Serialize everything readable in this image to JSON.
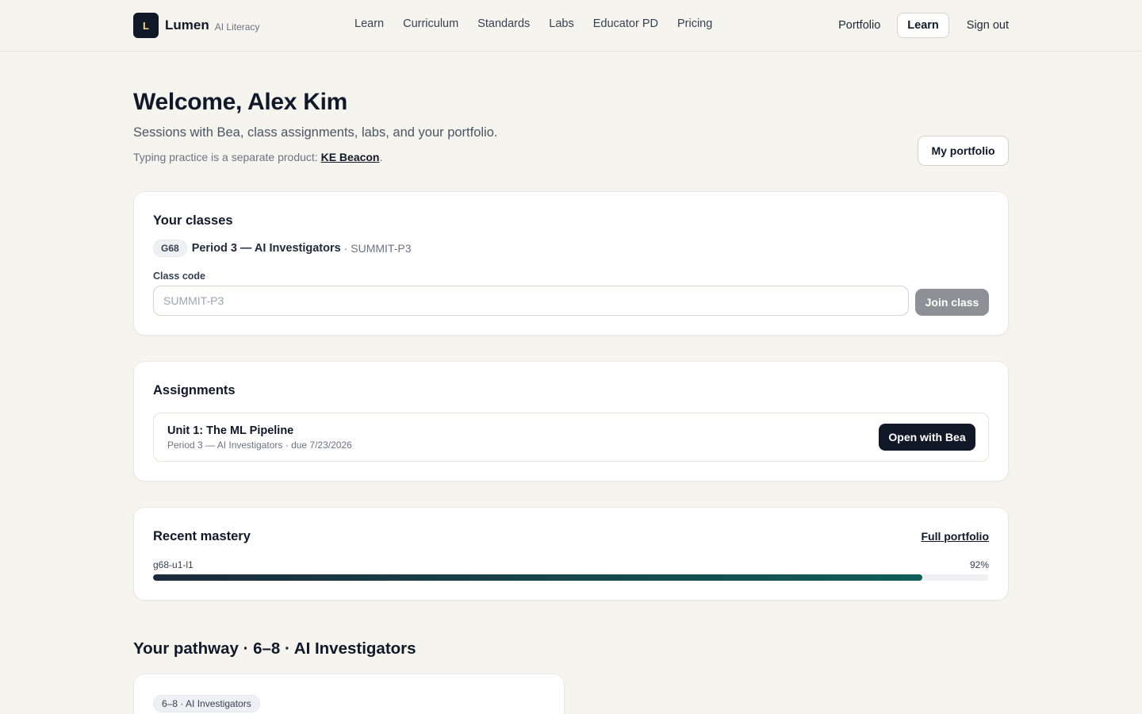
{
  "brand": {
    "logo_letter": "L",
    "name": "Lumen",
    "subtitle": "AI Literacy"
  },
  "nav": {
    "links": [
      "Learn",
      "Curriculum",
      "Standards",
      "Labs",
      "Educator PD",
      "Pricing"
    ],
    "portfolio": "Portfolio",
    "learn_active": "Learn",
    "sign_out": "Sign out"
  },
  "header": {
    "welcome": "Welcome, Alex Kim",
    "subtitle": "Sessions with Bea, class assignments, labs, and your portfolio.",
    "note_prefix": "Typing practice is a separate product: ",
    "note_link": "KE Beacon",
    "note_suffix": ".",
    "portfolio_button": "My portfolio"
  },
  "classes": {
    "title": "Your classes",
    "class_badge": "G68",
    "class_name": "Period 3 — AI Investigators",
    "class_code": "· SUMMIT-P3",
    "field_label": "Class code",
    "input_value": "",
    "input_placeholder": "SUMMIT-P3",
    "join_button": "Join class"
  },
  "assignments": {
    "title": "Assignments",
    "items": [
      {
        "title": "Unit 1: The ML Pipeline",
        "meta": "Period 3 — AI Investigators · due 7/23/2026",
        "action": "Open with Bea"
      }
    ]
  },
  "mastery": {
    "title": "Recent mastery",
    "link": "Full portfolio",
    "items": [
      {
        "label": "g68-u1-l1",
        "value_text": "92%",
        "value": 92
      }
    ],
    "colors": {
      "fill_start": "#1c2a3e",
      "fill_end": "#115e59",
      "track": "#eef1f4"
    }
  },
  "pathway": {
    "title": "Your pathway · 6–8 · AI Investigators",
    "badge": "6–8 · AI Investigators"
  }
}
